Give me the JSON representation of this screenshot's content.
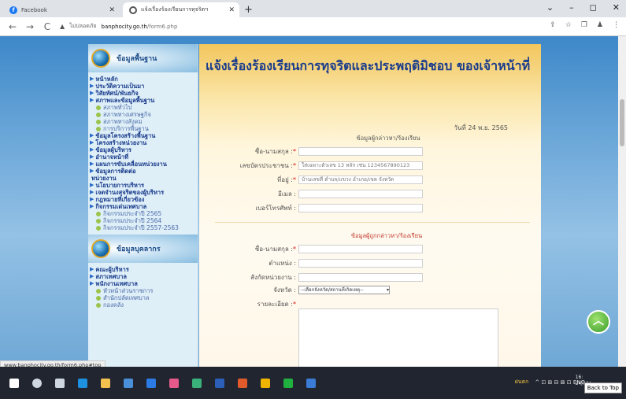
{
  "browser": {
    "tabs": [
      {
        "label": "Facebook",
        "active": false
      },
      {
        "label": "แจ้งเรื่องร้องเรียนการทุจริตฯ",
        "active": true
      }
    ],
    "new_tab": "+",
    "window_controls": [
      "⌄",
      "–",
      "◻",
      "✕"
    ],
    "nav": {
      "back": "←",
      "forward": "→",
      "reload": "C"
    },
    "url_warning": "▲",
    "url_security": "ไม่ปลอดภัย",
    "url_domain": "banphocity.go.th",
    "url_path": "/form6.php",
    "toolbar_icons": [
      "⇪",
      "☆",
      "❐",
      "♟",
      "⋮"
    ]
  },
  "sidebar": {
    "header1": "ข้อมูลพื้นฐาน",
    "menu1": [
      {
        "label": "หน้าหลัก",
        "type": "main"
      },
      {
        "label": "ประวัติความเป็นมา",
        "type": "main"
      },
      {
        "label": "วิสัยทัศน์/พันธกิจ",
        "type": "main"
      },
      {
        "label": "สภาพและข้อมูลพื้นฐาน",
        "type": "main"
      },
      {
        "label": "สภาพทั่วไป",
        "type": "sub"
      },
      {
        "label": "สภาพทางเศรษฐกิจ",
        "type": "sub"
      },
      {
        "label": "สภาพทางสังคม",
        "type": "sub"
      },
      {
        "label": "การบริการพื้นฐาน",
        "type": "sub"
      },
      {
        "label": "ข้อมูลโครงสร้างพื้นฐาน",
        "type": "main"
      },
      {
        "label": "โครงสร้างหน่วยงาน",
        "type": "main"
      },
      {
        "label": "ข้อมูลผู้บริหาร",
        "type": "main"
      },
      {
        "label": "อำนาจหน้าที่",
        "type": "main"
      },
      {
        "label": "แผนการขับเคลื่อนหน่วยงาน",
        "type": "main"
      },
      {
        "label": "ข้อมูลการติดต่อ",
        "type": "main"
      },
      {
        "label": "หน่วยงาน",
        "type": "cont"
      },
      {
        "label": "นโยบายการบริหาร",
        "type": "main"
      },
      {
        "label": "เจตจำนงสุจริตของผู้บริหาร",
        "type": "main"
      },
      {
        "label": "กฎหมายที่เกี่ยวข้อง",
        "type": "main"
      },
      {
        "label": "กิจกรรมเด่นเทศบาล",
        "type": "main"
      },
      {
        "label": "กิจกรรมประจำปี 2565",
        "type": "sub"
      },
      {
        "label": "กิจกรรมประจำปี 2564",
        "type": "sub"
      },
      {
        "label": "กิจกรรมประจำปี 2557-2563",
        "type": "sub"
      }
    ],
    "header2": "ข้อมูลบุคลากร",
    "menu2": [
      {
        "label": "คณะผู้บริหาร",
        "type": "main"
      },
      {
        "label": "สภาเทศบาล",
        "type": "main"
      },
      {
        "label": "พนักงานเทศบาล",
        "type": "main"
      },
      {
        "label": "หัวหน้าส่วนราชการ",
        "type": "sub"
      },
      {
        "label": "สำนักปลัดเทศบาล",
        "type": "sub"
      },
      {
        "label": "กองคลัง",
        "type": "sub"
      }
    ]
  },
  "main": {
    "title": "แจ้งเรื่องร้องเรียนการทุจริตและประพฤติมิชอบ ของเจ้าหน้าที่",
    "date": "วันที่ 24 พ.ย. 2565",
    "section1": "ข้อมูลผู้กล่าวหา/ร้องเรียน",
    "fields1": [
      {
        "label": "ชื่อ-นามสกุล :",
        "required": true,
        "placeholder": ""
      },
      {
        "label": "เลขบัตรประชาชน :",
        "required": true,
        "placeholder": "ใส่เฉพาะตัวเลข 13 หลัก เช่น 1234567890123"
      },
      {
        "label": "ที่อยู่ :",
        "required": true,
        "placeholder": "บ้านเลขที่ ตำบล/แขวง อำเภอ/เขต จังหวัด"
      },
      {
        "label": "อีเมล :",
        "required": false,
        "placeholder": ""
      },
      {
        "label": "เบอร์โทรศัพท์ :",
        "required": false,
        "placeholder": ""
      }
    ],
    "section2": "ข้อมูลผู้ถูกกล่าวหา/ร้องเรียน",
    "fields2": [
      {
        "label": "ชื่อ-นามสกุล :",
        "required": true
      },
      {
        "label": "ตำแหน่ง :",
        "required": false
      },
      {
        "label": "สังกัดหน่วยงาน :",
        "required": false
      }
    ],
    "province_label": "จังหวัด :",
    "province_value": "--เลือกจังหวัด/สถานที่เกิดเหตุ--",
    "detail_label": "รายละเอียด :",
    "required_mark": "*"
  },
  "status_url": "www.banphocity.go.th/form6.php#top",
  "backtop_icon": "︿",
  "taskbar": {
    "icons": [
      {
        "name": "windows-icon",
        "color": "#ffffff"
      },
      {
        "name": "search-icon",
        "color": "#cfd6e0"
      },
      {
        "name": "task-view-icon",
        "color": "#cfd6e0"
      },
      {
        "name": "edge-icon",
        "color": "#1e90e0"
      },
      {
        "name": "file-explorer-icon",
        "color": "#f2c14e"
      },
      {
        "name": "store-icon",
        "color": "#4a90d9"
      },
      {
        "name": "mail-icon",
        "color": "#2c7be5"
      },
      {
        "name": "paint-icon",
        "color": "#e55a8a"
      },
      {
        "name": "photos-icon",
        "color": "#3ab07a"
      },
      {
        "name": "word-icon",
        "color": "#2b5fb8"
      },
      {
        "name": "office-icon",
        "color": "#e05a2b"
      },
      {
        "name": "chrome-icon",
        "color": "#f0b400"
      },
      {
        "name": "line-icon",
        "color": "#20b040"
      },
      {
        "name": "app-icon",
        "color": "#3a7bd5"
      }
    ],
    "weather": "ฝนตก",
    "tray_text": "^ ⊡ ⊞ ⊟ ⊠ ⊡ ENG",
    "clock_time": "16:",
    "clock_date": "24/11/",
    "tooltip": "Back to Top"
  }
}
